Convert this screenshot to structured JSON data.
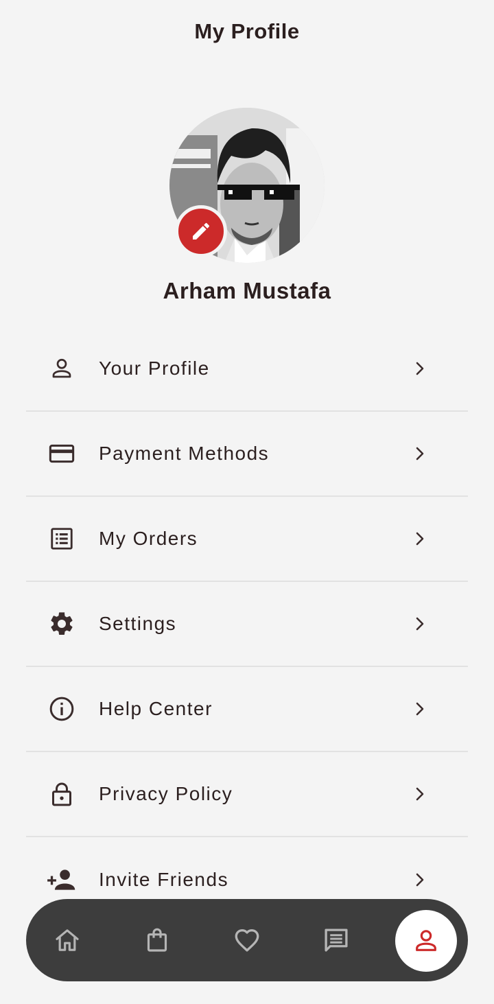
{
  "header": {
    "title": "My Profile"
  },
  "profile": {
    "name": "Arham Mustafa"
  },
  "menu": {
    "items": [
      {
        "label": "Your Profile",
        "icon": "person-icon"
      },
      {
        "label": "Payment Methods",
        "icon": "credit-card-icon"
      },
      {
        "label": "My Orders",
        "icon": "orders-list-icon"
      },
      {
        "label": "Settings",
        "icon": "gear-icon"
      },
      {
        "label": "Help Center",
        "icon": "info-icon"
      },
      {
        "label": "Privacy Policy",
        "icon": "lock-icon"
      },
      {
        "label": "Invite Friends",
        "icon": "add-person-icon"
      }
    ]
  },
  "bottom_nav": {
    "items": [
      {
        "name": "home",
        "icon": "home-icon"
      },
      {
        "name": "orders",
        "icon": "shopping-bag-icon"
      },
      {
        "name": "wishlist",
        "icon": "heart-icon"
      },
      {
        "name": "messages",
        "icon": "chat-icon"
      },
      {
        "name": "profile",
        "icon": "person-icon",
        "active": true
      }
    ]
  },
  "colors": {
    "accent": "#cc2a2a",
    "background": "#f4f4f4",
    "text": "#2b1f1f",
    "nav_bar": "#3d3d3d",
    "nav_icon": "#b5b5b5"
  }
}
